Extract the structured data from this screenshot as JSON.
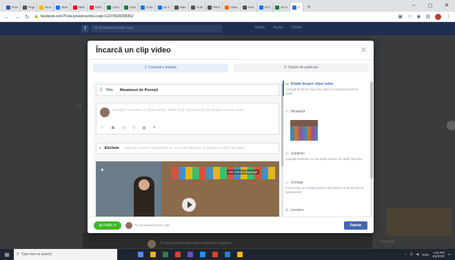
{
  "browser": {
    "tabs": [
      {
        "label": "Prim",
        "color": "#3b5998"
      },
      {
        "label": "Pagi",
        "color": "#555555"
      },
      {
        "label": "Sinu",
        "color": "#f4b400"
      },
      {
        "label": "Stan",
        "color": "#1a73e8"
      },
      {
        "label": "Netfl",
        "color": "#e50914"
      },
      {
        "label": "UNIT",
        "color": "#d93025"
      },
      {
        "label": "Com",
        "color": "#188038"
      },
      {
        "label": "Sum",
        "color": "#188038"
      },
      {
        "label": "Com",
        "color": "#1a73e8"
      },
      {
        "label": "Un li",
        "color": "#1a73e8"
      },
      {
        "label": "Wan",
        "color": "#555555"
      },
      {
        "label": "AUD",
        "color": "#555555"
      },
      {
        "label": "PRO",
        "color": "#555555"
      },
      {
        "label": "Adau",
        "color": "#e8710a"
      },
      {
        "label": "Fam",
        "color": "#555555"
      },
      {
        "label": "Lit fr",
        "color": "#1a73e8"
      },
      {
        "label": "25 In",
        "color": "#188038"
      },
      {
        "label": "C",
        "color": "#1a73e8",
        "active": true
      }
    ],
    "url": "facebook.com/70-de-povesti-pentru-copii-112379328298351/",
    "new_tab": "+",
    "controls": [
      "–",
      "◻",
      "✕"
    ]
  },
  "fb": {
    "search_placeholder": "70 de povesti pentru copii",
    "nav": [
      "Barjun",
      "Acasa",
      "Creare"
    ],
    "left_fragment": "Tir",
    "bottom_text": "70 de povesti pentru copii a distribuit o postare.",
    "right_bottom": "Chat (0/0)"
  },
  "modal": {
    "title": "Încarcă un clip video",
    "close": "✕",
    "steps": [
      "1. Creează o postare",
      "2. Opțiuni de publicare"
    ],
    "title_field": {
      "label": "Titlu",
      "value": "Maratonul de Povești"
    },
    "description_placeholder": "Adaugă o descriere a clipului video, astfel încât utilizatorii să știe despre ce este vorba.",
    "tags_field": {
      "label": "Etichete",
      "placeholder": "Adaugă cuvinte cheie pentru a-i ajuta pe utilizatori să găsească clipul tău video"
    },
    "video_caption": "Acti Select Language",
    "right_panel": [
      {
        "title": "Detalii despre clipul video",
        "desc": "Adaugă detalii la clipul tău video și creează postarea video",
        "active": true
      },
      {
        "title": "Miniatură",
        "desc": "",
        "active": false
      },
      {
        "title": "Subtitrări",
        "desc": "Adaugă subtitrări ca mai mulți oameni să vadă clipul tău",
        "active": false
      },
      {
        "title": "Sondaje",
        "desc": "Poți începe un sondaj pentru videoclipuri ca să știi opinia spectatorilor",
        "active": false
      },
      {
        "title": "Urmărire",
        "desc": "",
        "active": false
      }
    ],
    "footer": {
      "visibility": "Public",
      "page_name": "70 de povesti pentru copii",
      "publish": "Înainte"
    }
  },
  "taskbar": {
    "search_placeholder": "Type here to search",
    "time": "1:46 PM",
    "date": "3/1/2020",
    "lang": "ROU",
    "apps": [
      "#4f8ef7",
      "#f5b400",
      "#2d7d46",
      "#e0403a",
      "#6b4fbb",
      "#1e90ff",
      "#d24726",
      "#2b7cd3",
      "#ffb900"
    ]
  }
}
